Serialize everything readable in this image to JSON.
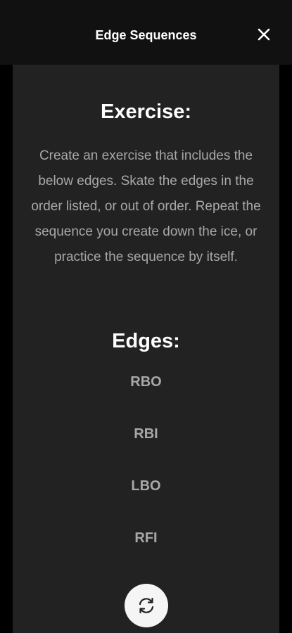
{
  "header": {
    "title": "Edge Sequences",
    "close_icon": "close-icon"
  },
  "exercise": {
    "heading": "Exercise:",
    "description": "Create an exercise that includes the below edges. Skate the edges in the order listed, or out of order. Repeat the sequence you create down the ice, or practice the sequence by itself."
  },
  "edges": {
    "heading": "Edges:",
    "items": [
      "RBO",
      "RBI",
      "LBO",
      "RFI"
    ]
  },
  "refresh": {
    "icon": "refresh-icon"
  },
  "colors": {
    "background": "#000000",
    "header": "#111111",
    "card": "#222222",
    "heading_text": "#ffffff",
    "body_text": "#a8a8a8",
    "refresh_button": "#f5f5f5"
  }
}
